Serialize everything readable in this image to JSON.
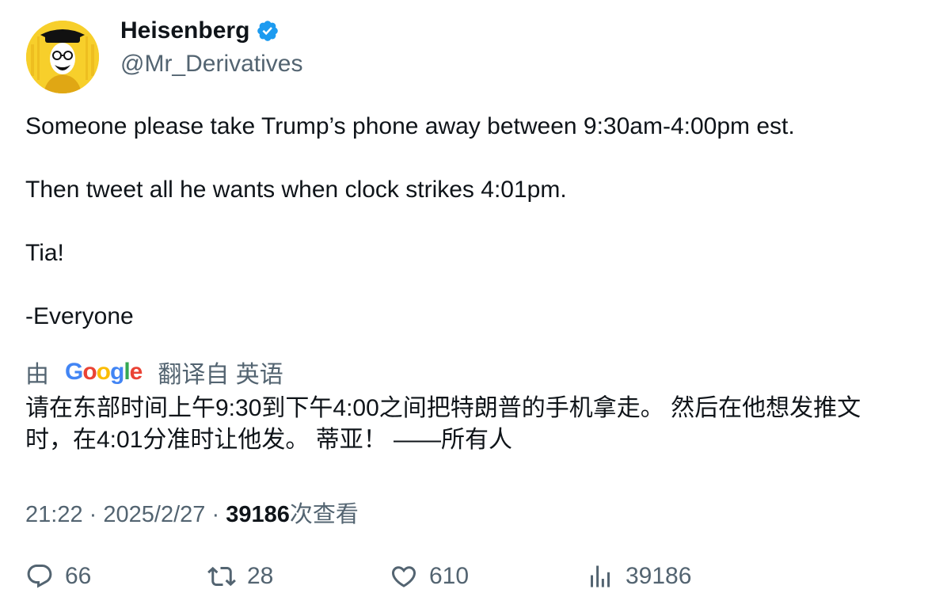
{
  "author": {
    "name": "Heisenberg",
    "handle": "@Mr_Derivatives",
    "verified_color": "#1d9bf0",
    "avatar_bg": "#f7cf2b"
  },
  "tweet": {
    "lines": [
      "Someone please take Trump’s phone away between 9:30am-4:00pm est.",
      "Then tweet all he wants when clock strikes 4:01pm.",
      "Tia!",
      "-Everyone"
    ]
  },
  "translation": {
    "by": "由",
    "google": "Google",
    "from": "翻译自 英语",
    "line1": "请在东部时间上午9:30到下午4:00之间把特朗普的手机拿走。 然后在他想发推文",
    "line2": "时，在4:01分准时让他发。 蒂亚！ ——所有人"
  },
  "meta": {
    "time": "21:22",
    "sep": "·",
    "date": "2025/2/27",
    "views_count": "39186",
    "views_label": "次查看"
  },
  "actions": {
    "replies": "66",
    "retweets": "28",
    "likes": "610",
    "views": "39186"
  }
}
